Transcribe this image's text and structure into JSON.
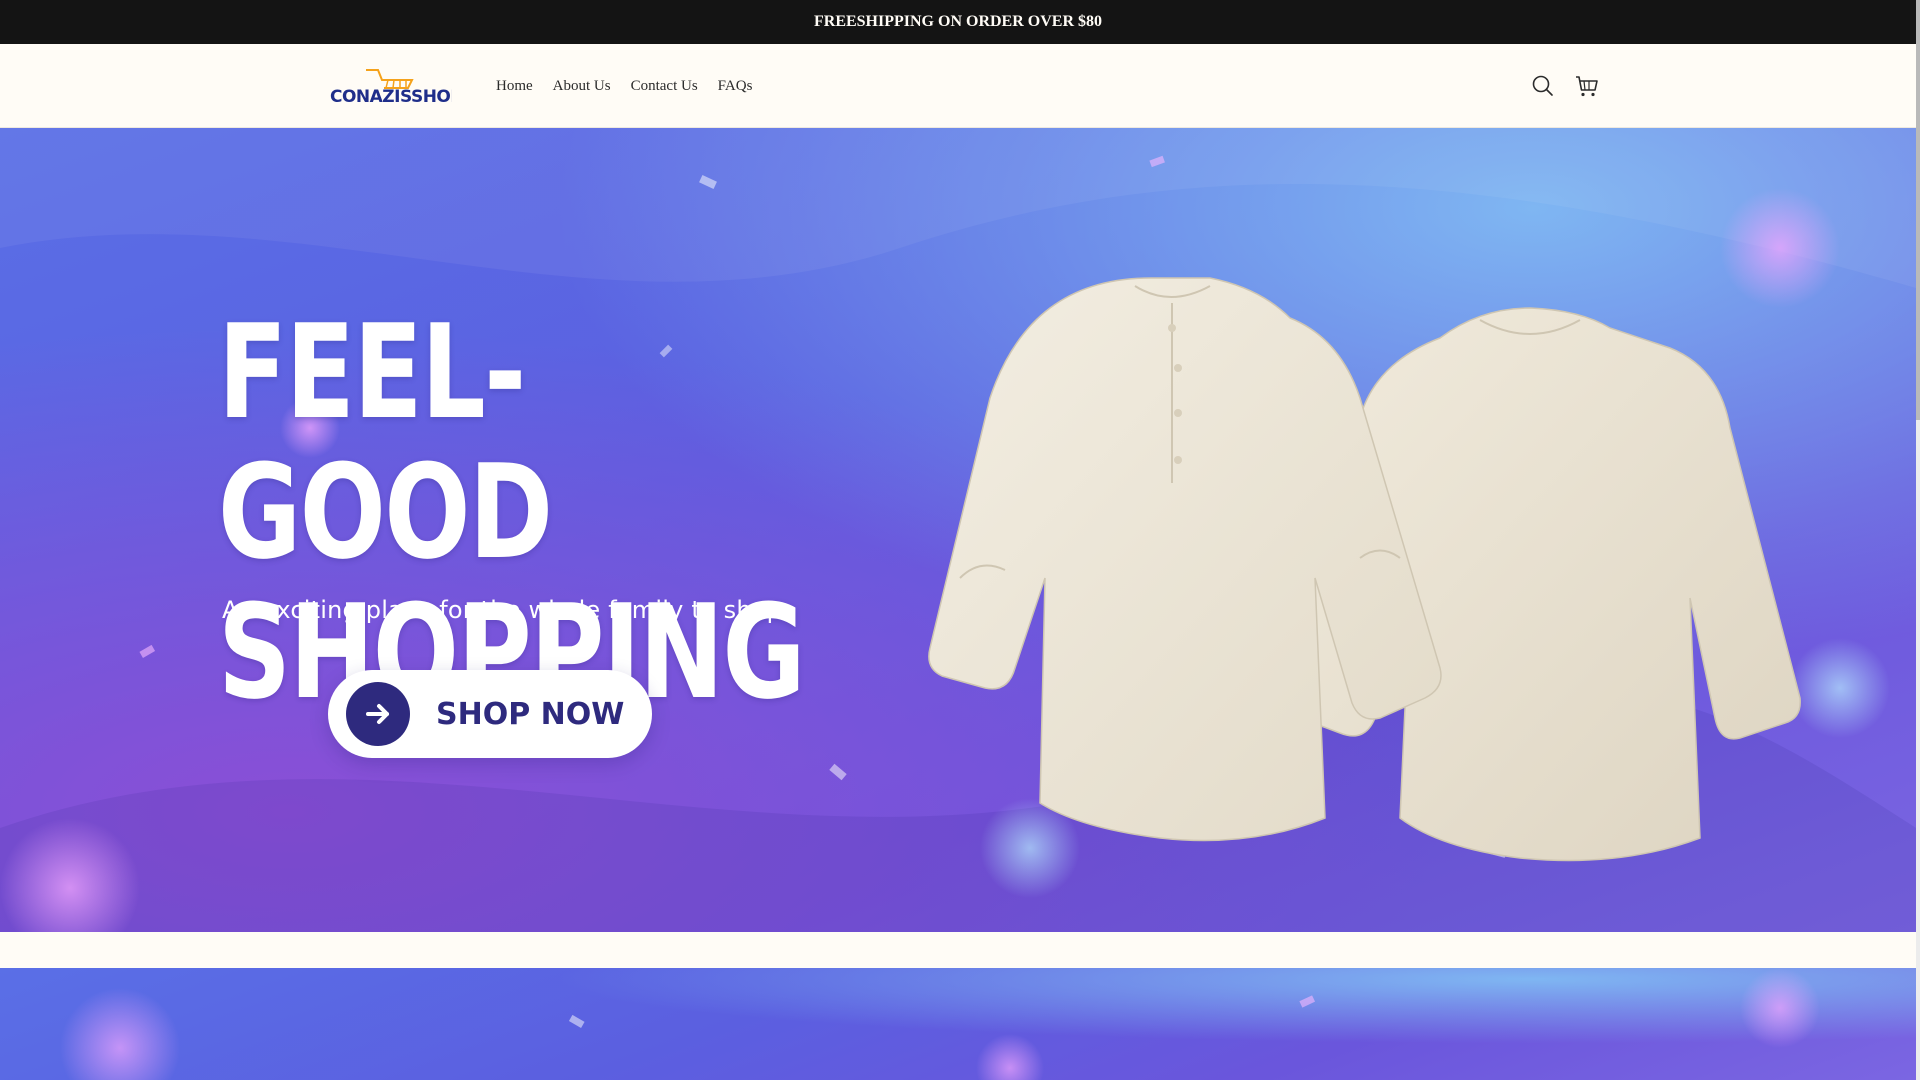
{
  "announcement": {
    "text": "FREESHIPPING ON ORDER OVER $80"
  },
  "header": {
    "logo_text": "CONAZISSHOP",
    "nav": [
      {
        "label": "Home"
      },
      {
        "label": "About Us"
      },
      {
        "label": "Contact Us"
      },
      {
        "label": "FAQs"
      }
    ],
    "icons": [
      "search-icon",
      "cart-icon"
    ]
  },
  "hero": {
    "title_line1": "FEEL-GOOD",
    "title_line2": "SHOPPING",
    "subtitle": "An exciting place for the whole family to shop",
    "cta_label": "SHOP NOW",
    "cta_icon": "arrow-right-icon",
    "image": "beige-linen-shirt-front-and-back"
  },
  "colors": {
    "announcement_bg": "#141414",
    "page_bg": "#fffcf6",
    "hero_blue": "#5b5fe0",
    "hero_purple": "#7b66e2",
    "cta_dark": "#2e2a7e",
    "logo_blue": "#1f2e8a",
    "logo_orange": "#f5a21b"
  }
}
